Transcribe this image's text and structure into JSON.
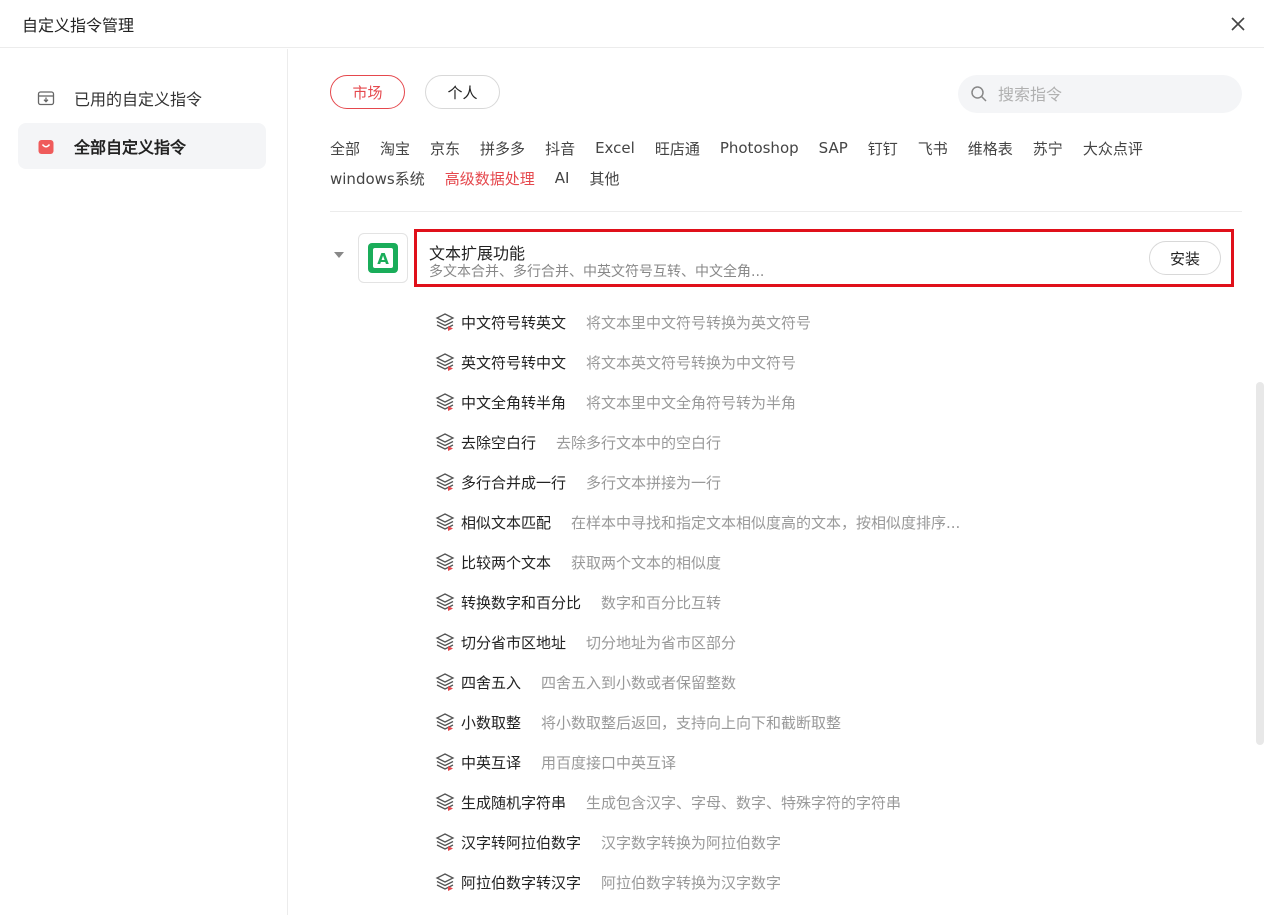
{
  "window": {
    "title": "自定义指令管理"
  },
  "sidebar": {
    "items": [
      {
        "label": "已用的自定义指令",
        "icon": "inbox-download-icon"
      },
      {
        "label": "全部自定义指令",
        "icon": "shopping-bag-icon",
        "active": true
      }
    ]
  },
  "tabs": {
    "market": "市场",
    "personal": "个人"
  },
  "search": {
    "placeholder": "搜索指令"
  },
  "categories": {
    "row1": [
      "全部",
      "淘宝",
      "京东",
      "拼多多",
      "抖音",
      "Excel",
      "旺店通",
      "Photoshop",
      "SAP",
      "钉钉",
      "飞书",
      "维格表",
      "苏宁",
      "大众点评"
    ],
    "row2": [
      "windows系统",
      "高级数据处理",
      "AI",
      "其他"
    ],
    "active": "高级数据处理"
  },
  "package": {
    "name": "文本扩展功能",
    "desc": "多文本合并、多行合并、中英文符号互转、中文全角...",
    "install_label": "安装",
    "icon_letter": "A",
    "icon_color": "#1aad5a"
  },
  "commands": [
    {
      "name": "中文符号转英文",
      "desc": "将文本里中文符号转换为英文符号"
    },
    {
      "name": "英文符号转中文",
      "desc": "将文本英文符号转换为中文符号"
    },
    {
      "name": "中文全角转半角",
      "desc": "将文本里中文全角符号转为半角"
    },
    {
      "name": "去除空白行",
      "desc": "去除多行文本中的空白行"
    },
    {
      "name": "多行合并成一行",
      "desc": "多行文本拼接为一行"
    },
    {
      "name": "相似文本匹配",
      "desc": "在样本中寻找和指定文本相似度高的文本，按相似度排序..."
    },
    {
      "name": "比较两个文本",
      "desc": "获取两个文本的相似度"
    },
    {
      "name": "转换数字和百分比",
      "desc": "数字和百分比互转"
    },
    {
      "name": "切分省市区地址",
      "desc": "切分地址为省市区部分"
    },
    {
      "name": "四舍五入",
      "desc": "四舍五入到小数或者保留整数"
    },
    {
      "name": "小数取整",
      "desc": "将小数取整后返回，支持向上向下和截断取整"
    },
    {
      "name": "中英互译",
      "desc": "用百度接口中英互译"
    },
    {
      "name": "生成随机字符串",
      "desc": "生成包含汉字、字母、数字、特殊字符的字符串"
    },
    {
      "name": "汉字转阿拉伯数字",
      "desc": "汉字数字转换为阿拉伯数字"
    },
    {
      "name": "阿拉伯数字转汉字",
      "desc": "阿拉伯数字转换为汉字数字"
    }
  ],
  "colors": {
    "accent": "#e5484d",
    "highlight_border": "#e0101a"
  }
}
